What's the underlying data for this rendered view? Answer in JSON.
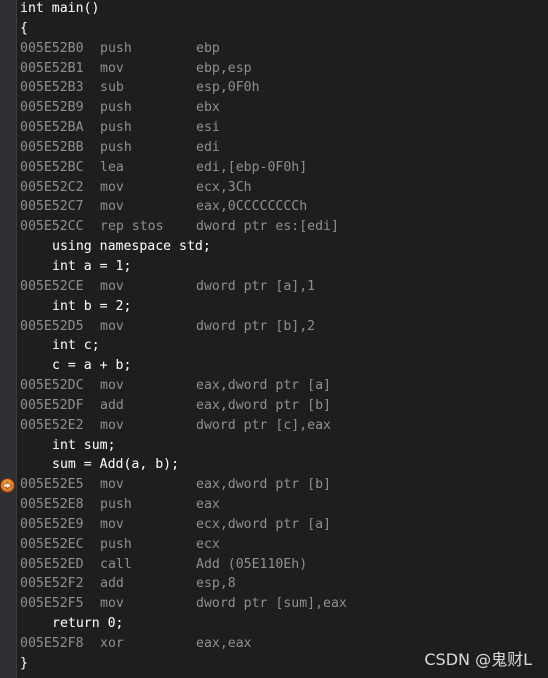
{
  "lines": [
    {
      "kind": "src",
      "indent": false,
      "text": "int main()"
    },
    {
      "kind": "src",
      "indent": false,
      "text": "{"
    },
    {
      "kind": "asm",
      "addr": "005E52B0",
      "mn": "push",
      "op": "ebp"
    },
    {
      "kind": "asm",
      "addr": "005E52B1",
      "mn": "mov",
      "op": "ebp,esp"
    },
    {
      "kind": "asm",
      "addr": "005E52B3",
      "mn": "sub",
      "op": "esp,0F0h"
    },
    {
      "kind": "asm",
      "addr": "005E52B9",
      "mn": "push",
      "op": "ebx"
    },
    {
      "kind": "asm",
      "addr": "005E52BA",
      "mn": "push",
      "op": "esi"
    },
    {
      "kind": "asm",
      "addr": "005E52BB",
      "mn": "push",
      "op": "edi"
    },
    {
      "kind": "asm",
      "addr": "005E52BC",
      "mn": "lea",
      "op": "edi,[ebp-0F0h]"
    },
    {
      "kind": "asm",
      "addr": "005E52C2",
      "mn": "mov",
      "op": "ecx,3Ch"
    },
    {
      "kind": "asm",
      "addr": "005E52C7",
      "mn": "mov",
      "op": "eax,0CCCCCCCCh"
    },
    {
      "kind": "asm",
      "addr": "005E52CC",
      "mn": "rep stos",
      "op": "dword ptr es:[edi]"
    },
    {
      "kind": "src",
      "indent": true,
      "text": "using namespace std;"
    },
    {
      "kind": "src",
      "indent": true,
      "text": "int a = 1;"
    },
    {
      "kind": "asm",
      "addr": "005E52CE",
      "mn": "mov",
      "op": "dword ptr [a],1"
    },
    {
      "kind": "src",
      "indent": true,
      "text": "int b = 2;"
    },
    {
      "kind": "asm",
      "addr": "005E52D5",
      "mn": "mov",
      "op": "dword ptr [b],2"
    },
    {
      "kind": "src",
      "indent": true,
      "text": "int c;"
    },
    {
      "kind": "src",
      "indent": true,
      "text": "c = a + b;"
    },
    {
      "kind": "asm",
      "addr": "005E52DC",
      "mn": "mov",
      "op": "eax,dword ptr [a]"
    },
    {
      "kind": "asm",
      "addr": "005E52DF",
      "mn": "add",
      "op": "eax,dword ptr [b]"
    },
    {
      "kind": "asm",
      "addr": "005E52E2",
      "mn": "mov",
      "op": "dword ptr [c],eax"
    },
    {
      "kind": "src",
      "indent": true,
      "text": "int sum;"
    },
    {
      "kind": "src",
      "indent": true,
      "text": "sum = Add(a, b);"
    },
    {
      "kind": "asm",
      "addr": "005E52E5",
      "mn": "mov",
      "op": "eax,dword ptr [b]",
      "current": true
    },
    {
      "kind": "asm",
      "addr": "005E52E8",
      "mn": "push",
      "op": "eax"
    },
    {
      "kind": "asm",
      "addr": "005E52E9",
      "mn": "mov",
      "op": "ecx,dword ptr [a]"
    },
    {
      "kind": "asm",
      "addr": "005E52EC",
      "mn": "push",
      "op": "ecx"
    },
    {
      "kind": "asm",
      "addr": "005E52ED",
      "mn": "call",
      "op": "Add (05E110Eh)"
    },
    {
      "kind": "asm",
      "addr": "005E52F2",
      "mn": "add",
      "op": "esp,8"
    },
    {
      "kind": "asm",
      "addr": "005E52F5",
      "mn": "mov",
      "op": "dword ptr [sum],eax"
    },
    {
      "kind": "src",
      "indent": true,
      "text": "return 0;"
    },
    {
      "kind": "asm",
      "addr": "005E52F8",
      "mn": "xor",
      "op": "eax,eax"
    },
    {
      "kind": "src",
      "indent": false,
      "text": "}"
    }
  ],
  "breakpoint_icon": "current-instruction-arrow-icon",
  "watermark": "CSDN @鬼财L"
}
